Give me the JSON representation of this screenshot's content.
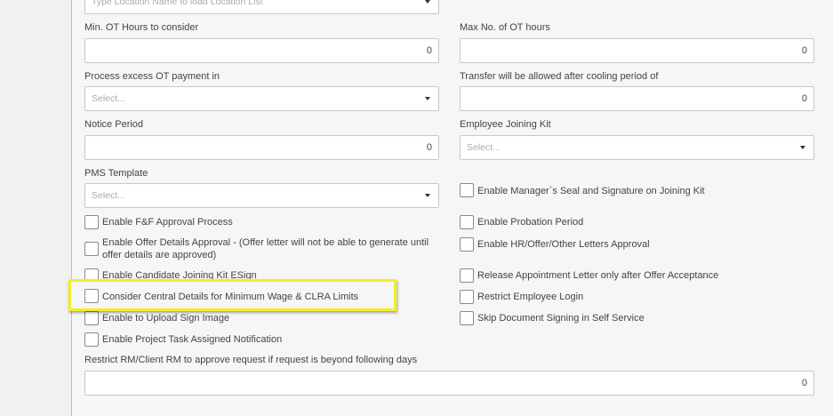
{
  "location_list": {
    "placeholder": "Type Location Name to load Location List"
  },
  "fields": {
    "min_ot_hours": {
      "label": "Min. OT Hours to consider",
      "value": "0"
    },
    "max_ot_hours": {
      "label": "Max No. of OT hours",
      "value": "0"
    },
    "excess_ot_payment": {
      "label": "Process excess OT payment in",
      "placeholder": "Select..."
    },
    "transfer_cooling": {
      "label": "Transfer will be allowed after cooling period of",
      "value": "0"
    },
    "notice_period": {
      "label": "Notice Period",
      "value": "0"
    },
    "joining_kit": {
      "label": "Employee Joining Kit",
      "placeholder": "Select..."
    },
    "pms_template": {
      "label": "PMS Template",
      "placeholder": "Select..."
    },
    "restrict_rm": {
      "label": "Restrict RM/Client RM to approve request if request is beyond following days",
      "value": "0"
    }
  },
  "checkboxes": {
    "manager_seal": "Enable Manager`s Seal and Signature on Joining Kit",
    "ff_approval": "Enable F&F Approval Process",
    "probation": "Enable Probation Period",
    "offer_details_line1": "Enable Offer Details Approval - (Offer letter will not be able to generate until",
    "offer_details_line2": "offer details are approved)",
    "hr_letters": "Enable HR/Offer/Other Letters Approval",
    "candidate_esign": "Enable Candidate Joining Kit ESign",
    "release_appointment": "Release Appointment Letter only after Offer Acceptance",
    "central_details": "Consider Central Details for Minimum Wage & CLRA Limits",
    "restrict_login": "Restrict Employee Login",
    "upload_sign": "Enable to Upload Sign Image",
    "skip_signing": "Skip Document Signing in Self Service",
    "project_task": "Enable Project Task Assigned Notification"
  }
}
